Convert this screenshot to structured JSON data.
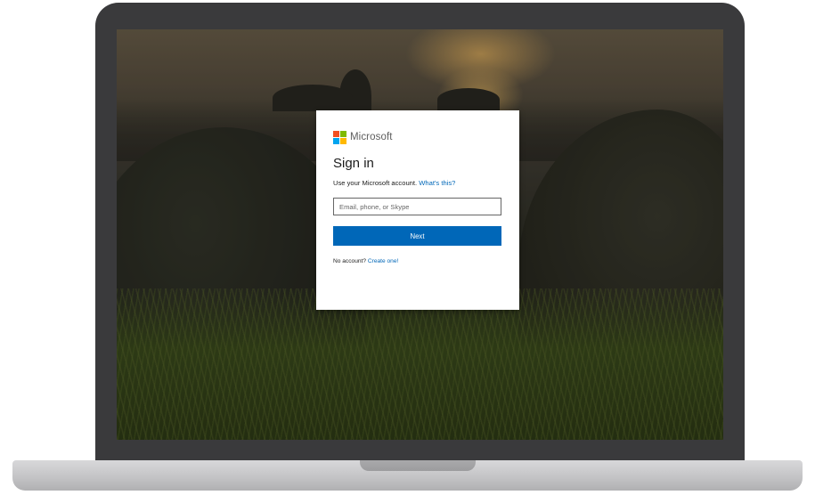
{
  "signin": {
    "brand": "Microsoft",
    "title": "Sign in",
    "subtitle": "Use your Microsoft account.",
    "help_link": "What's this?",
    "email_placeholder": "Email, phone, or Skype",
    "email_value": "",
    "next_label": "Next",
    "no_account_text": "No account?",
    "create_link": "Create one!"
  },
  "icons": {
    "brand_logo": "microsoft-logo-icon"
  },
  "colors": {
    "accent": "#0067b8",
    "logo_red": "#f25022",
    "logo_green": "#7fba00",
    "logo_blue": "#00a4ef",
    "logo_yellow": "#ffb900",
    "laptop_bezel": "#3a3a3c"
  }
}
